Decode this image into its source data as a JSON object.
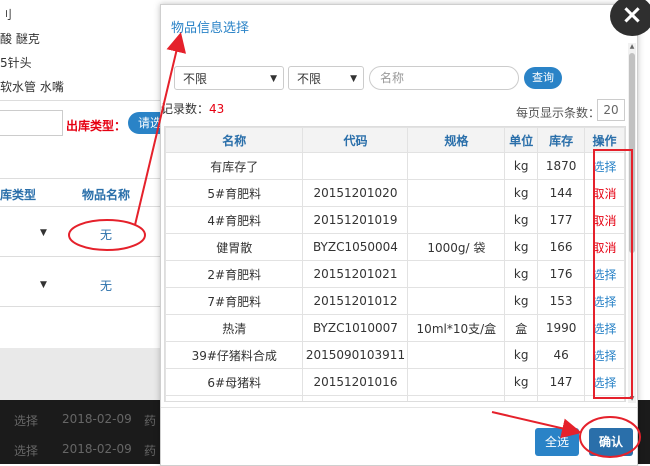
{
  "background": {
    "side_texts": [
      "刂",
      "酸 醚克",
      "5针头",
      "软水管 水嘴"
    ],
    "out_type_label": "出库类型：",
    "select_btn": "请选",
    "table_headers": [
      "库类型",
      "物品名称"
    ],
    "rows": [
      {
        "item": "无"
      },
      {
        "item": "无"
      }
    ],
    "dark_rows": [
      {
        "action": "选择",
        "date": "2018-02-09",
        "extra": "药"
      },
      {
        "action": "选择",
        "date": "2018-02-09",
        "extra": "药"
      }
    ]
  },
  "modal": {
    "title": "物品信息选择",
    "close_icon": "×",
    "filter1": "不限",
    "filter2": "不限",
    "search_placeholder": "名称",
    "query_label": "查询",
    "record_label": "记录数：",
    "record_count": "43",
    "page_size_label": "每页显示条数：",
    "page_size": "20",
    "columns": [
      "名称",
      "代码",
      "规格",
      "单位",
      "库存",
      "操作"
    ],
    "rows": [
      {
        "name": "有库存了",
        "code": "",
        "spec": "",
        "unit": "kg",
        "stock": "1870",
        "op": "选择"
      },
      {
        "name": "5#育肥料",
        "code": "20151201020",
        "spec": "",
        "unit": "kg",
        "stock": "144",
        "op": "取消"
      },
      {
        "name": "4#育肥料",
        "code": "20151201019",
        "spec": "",
        "unit": "kg",
        "stock": "177",
        "op": "取消"
      },
      {
        "name": "健胃散",
        "code": "BYZC1050004",
        "spec": "1000g/ 袋",
        "unit": "kg",
        "stock": "166",
        "op": "取消"
      },
      {
        "name": "2#育肥料",
        "code": "20151201021",
        "spec": "",
        "unit": "kg",
        "stock": "176",
        "op": "选择"
      },
      {
        "name": "7#育肥料",
        "code": "20151201012",
        "spec": "",
        "unit": "kg",
        "stock": "153",
        "op": "选择"
      },
      {
        "name": "热清",
        "code": "BYZC1010007",
        "spec": "10ml*10支/盒",
        "unit": "盒",
        "stock": "1990",
        "op": "选择"
      },
      {
        "name": "39#仔猪料合成",
        "code": "2015090103911",
        "spec": "",
        "unit": "kg",
        "stock": "46",
        "op": "选择"
      },
      {
        "name": "6#母猪料",
        "code": "20151201016",
        "spec": "",
        "unit": "kg",
        "stock": "147",
        "op": "选择"
      },
      {
        "name": "",
        "code": "",
        "spec": "",
        "unit": "",
        "stock": "",
        "op": ""
      }
    ],
    "select_all_label": "全选",
    "confirm_label": "确认"
  },
  "colors": {
    "accent": "#2a83c7",
    "red": "#e60012",
    "annotation": "#e5212b"
  }
}
